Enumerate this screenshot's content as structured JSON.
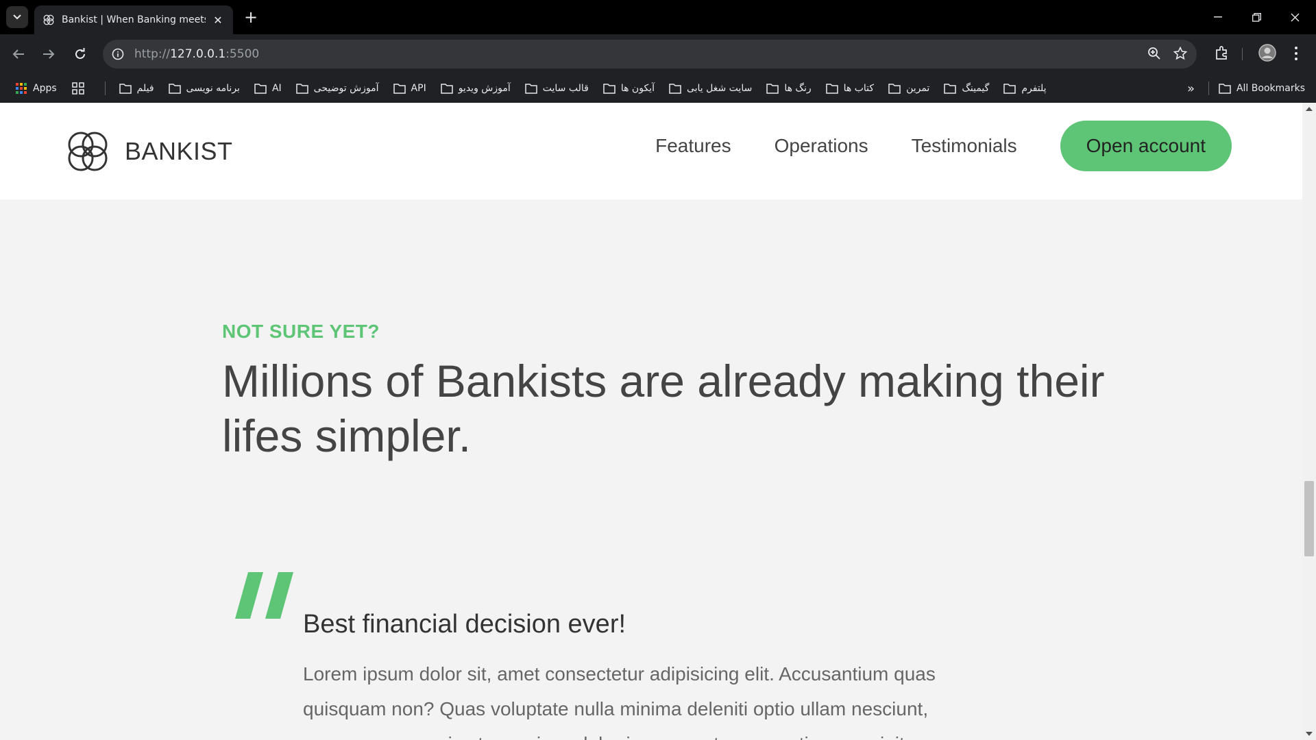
{
  "browser": {
    "tab_title": "Bankist | When Banking meets Minimalist",
    "url_scheme": "http://",
    "url_host": "127.0.0.1",
    "url_port": ":5500",
    "bookmarks": {
      "apps": "Apps",
      "items": [
        "فیلم",
        "برنامه نویسی",
        "AI",
        "آموزش توضیحی",
        "API",
        "آموزش ویدیو",
        "قالب سایت",
        "آیکون ها",
        "سایت شغل یابی",
        "رنگ ها",
        "کتاب ها",
        "تمرین",
        "گیمینگ",
        "پلتفرم"
      ],
      "all_bookmarks": "All Bookmarks"
    }
  },
  "site": {
    "logo_text": "BANKIST",
    "nav": {
      "features": "Features",
      "operations": "Operations",
      "testimonials": "Testimonials",
      "cta": "Open account"
    },
    "section": {
      "label": "NOT SURE YET?",
      "heading": "Millions of Bankists are already making their lifes simpler."
    },
    "testimonial": {
      "title": "Best financial decision ever!",
      "text": "Lorem ipsum dolor sit, amet consectetur adipisicing elit. Accusantium quas quisquam non? Quas voluptate nulla minima deleniti optio ullam nesciunt, numquam corporis et asperiores laboriosam sunt, praesentium suscipit"
    }
  },
  "colors": {
    "accent": "#5ec576",
    "page_bg": "#f3f3f3",
    "chrome_bg": "#202124"
  }
}
